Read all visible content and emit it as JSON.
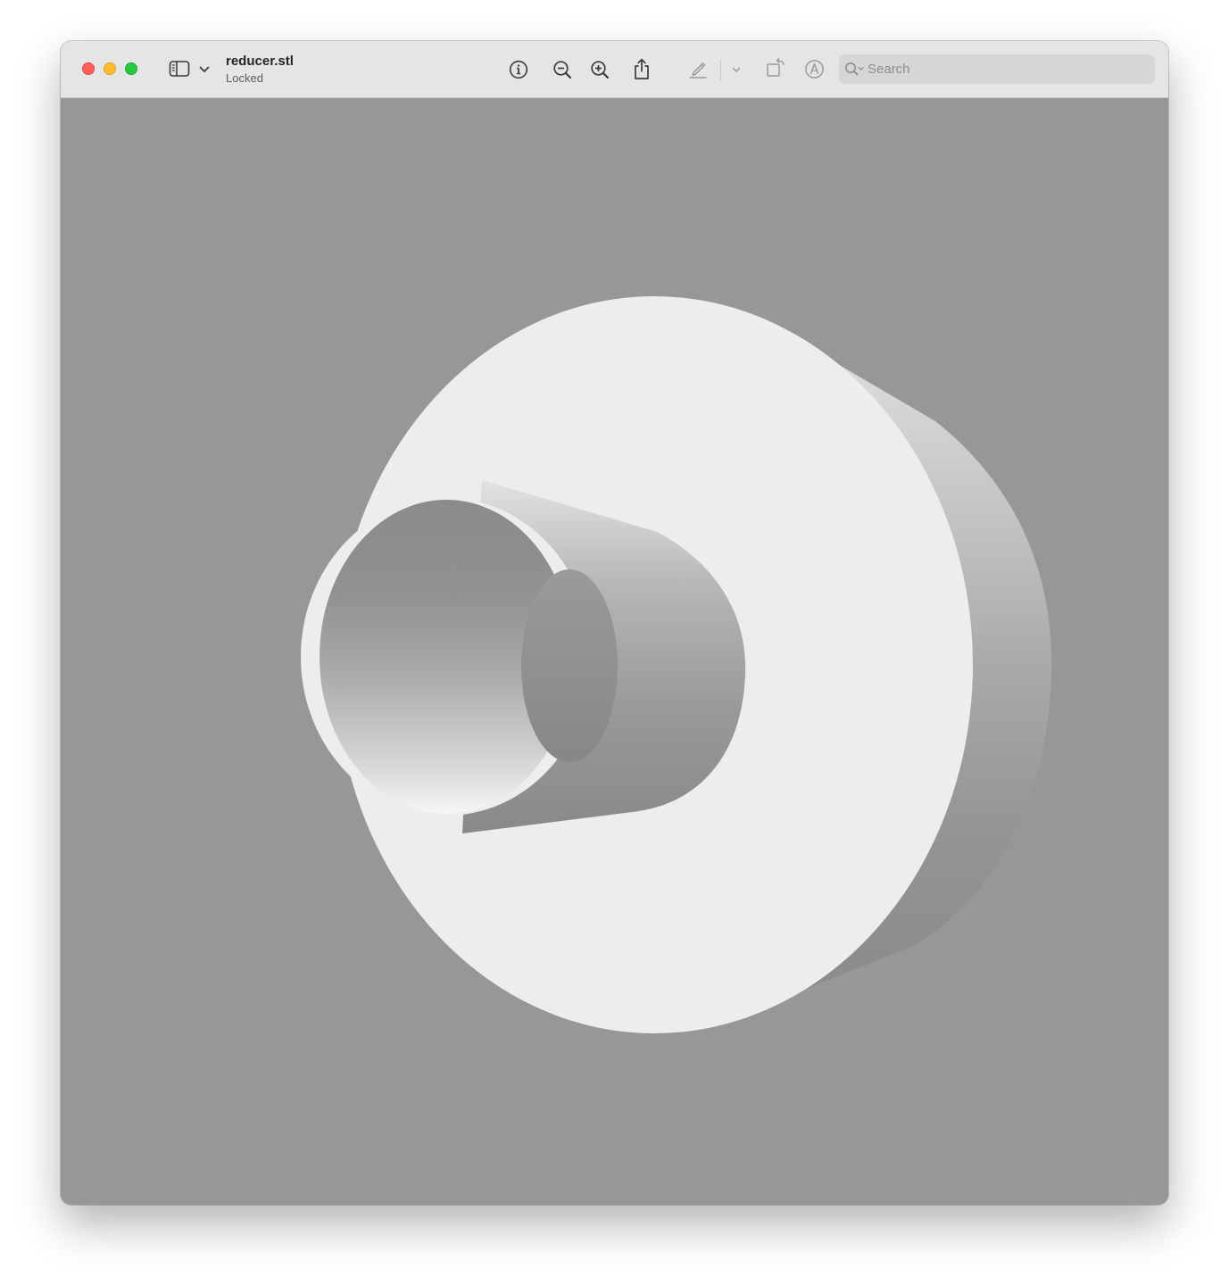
{
  "window": {
    "title": "reducer.stl",
    "subtitle": "Locked"
  },
  "toolbar": {
    "sidebar_toggle_icon": "sidebar-icon",
    "sidebar_menu_icon": "chevron-down-icon",
    "info_icon": "info-circle-icon",
    "zoom_out_icon": "zoom-out-icon",
    "zoom_in_icon": "zoom-in-icon",
    "share_icon": "share-icon",
    "markup_icon": "pencil-icon",
    "markup_menu_icon": "chevron-down-icon",
    "rotate_icon": "rotate-icon",
    "annotate_icon": "markup-circle-icon"
  },
  "search": {
    "placeholder": "Search",
    "value": ""
  },
  "viewport": {
    "model": "reducer",
    "background_color": "#979797",
    "face_color": "#ededed"
  },
  "colors": {
    "close": "#fe5f57",
    "minimize": "#febc2e",
    "zoom": "#28c840",
    "titlebar": "#e6e5e6"
  }
}
